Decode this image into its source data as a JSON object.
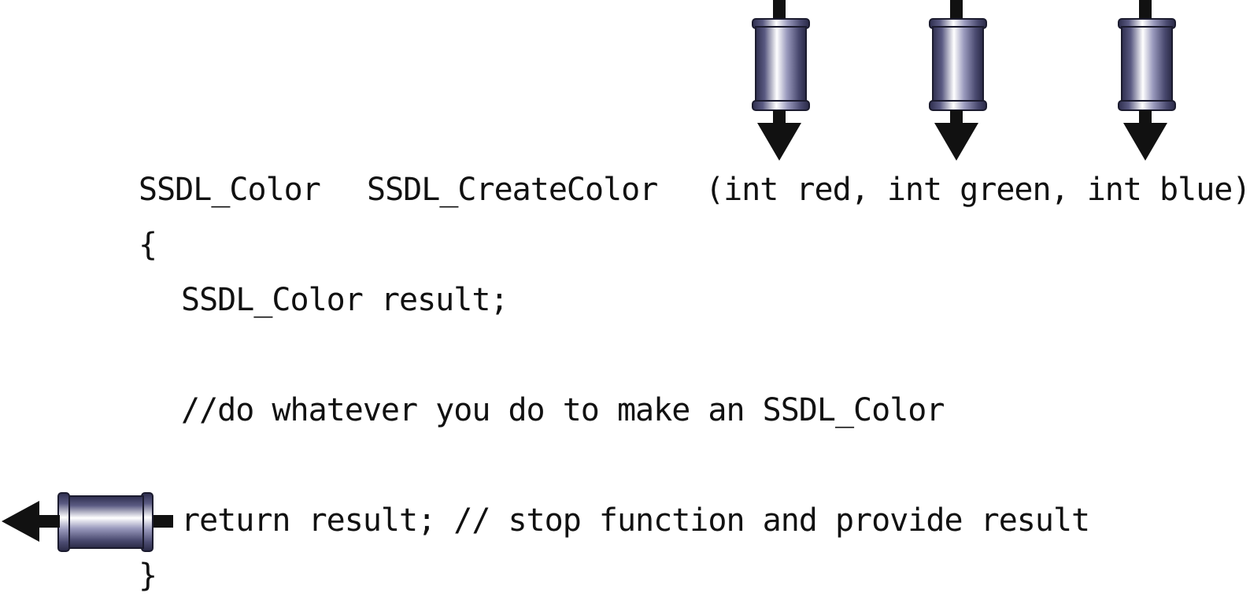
{
  "code": {
    "signature": {
      "return_type": "SSDL_Color",
      "function_name": "SSDL_CreateColor",
      "parameters": "(int red, int green, int blue)"
    },
    "open_brace": "{",
    "declaration": "SSDL_Color result;",
    "comment": "//do whatever you do to make an SSDL_Color",
    "return_statement": "return result; // stop function and provide result",
    "close_brace": "}"
  },
  "pipes": {
    "inputs": [
      "red",
      "green",
      "blue"
    ],
    "output": "result"
  },
  "colors": {
    "text": "#111111",
    "arrow": "#111111",
    "pipe_dark": "#3a3a5c",
    "pipe_mid": "#7a7aa0",
    "pipe_light": "#ffffff"
  }
}
